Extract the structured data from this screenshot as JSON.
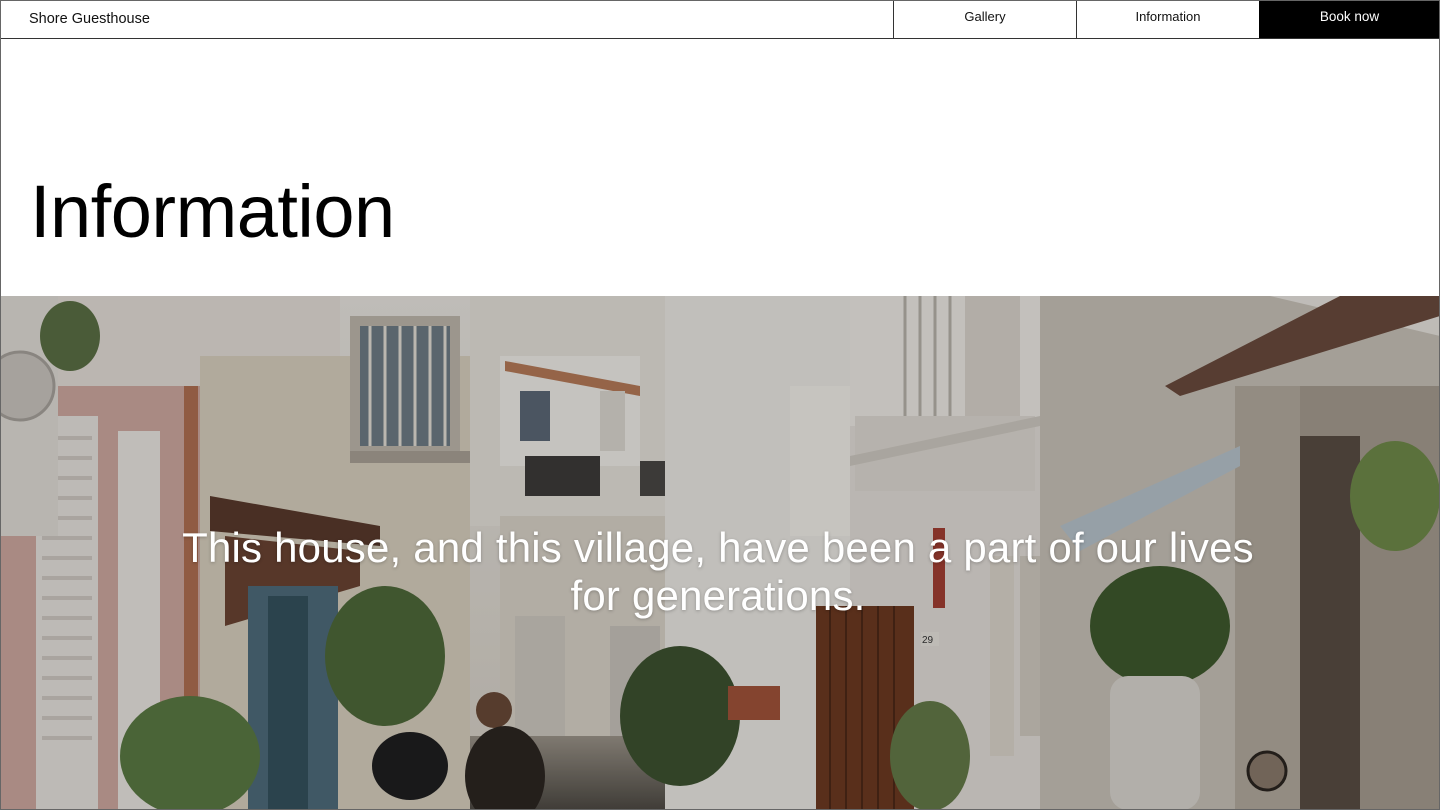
{
  "header": {
    "brand": "Shore Guesthouse",
    "nav": [
      {
        "label": "Gallery"
      },
      {
        "label": "Information"
      }
    ],
    "cta_label": "Book now"
  },
  "page": {
    "title": "Information"
  },
  "hero": {
    "quote": "This house, and this village, have been a part of our lives for generations.",
    "house_number": "29"
  },
  "colors": {
    "cta_background": "#000000",
    "cta_text": "#ffffff",
    "border": "#333333"
  }
}
